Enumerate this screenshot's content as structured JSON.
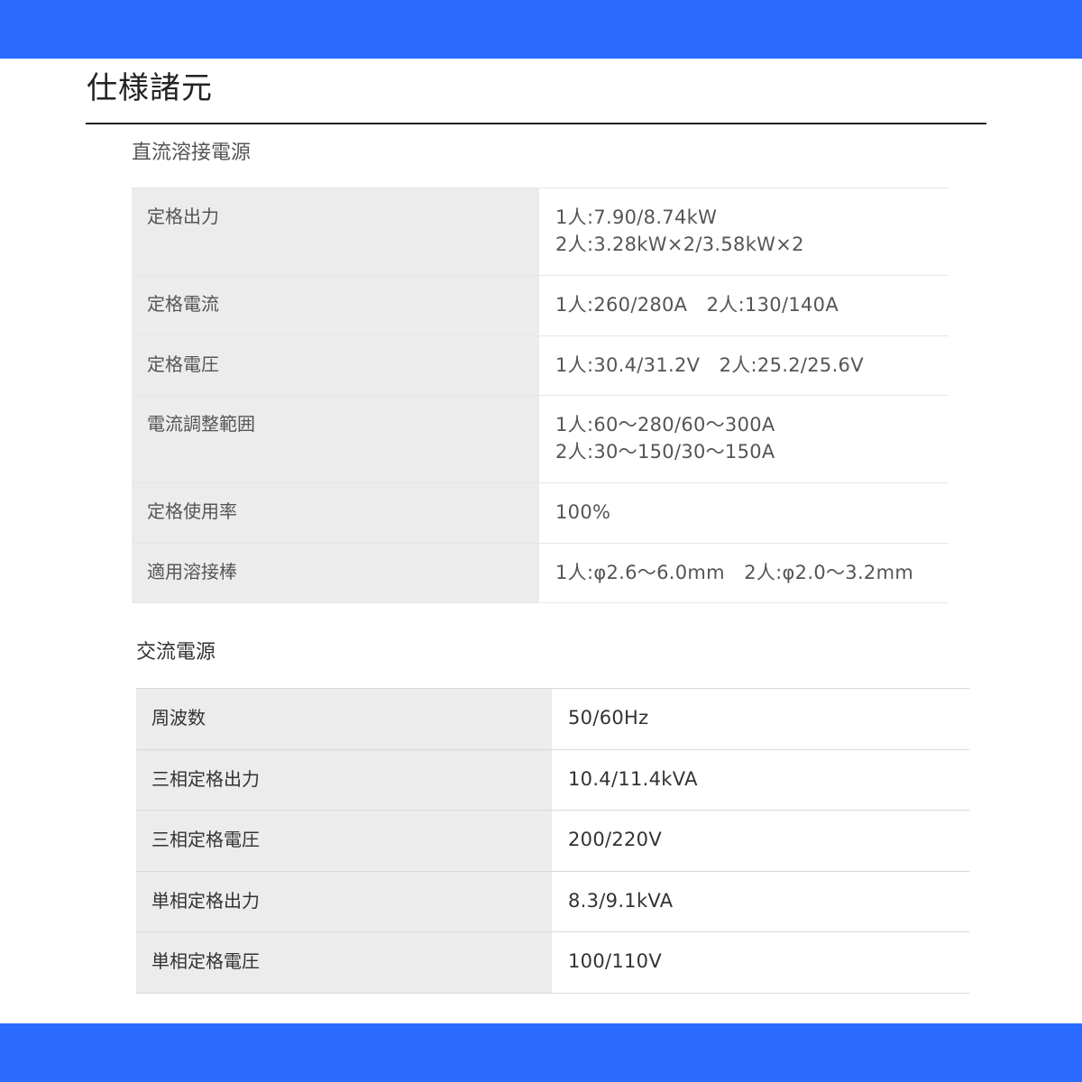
{
  "colors": {
    "accent_bar": "#2a6aff",
    "label_cell_bg": "#ececec",
    "title_rule": "#222222"
  },
  "page_title": "仕様諸元",
  "dc_section": {
    "heading": "直流溶接電源",
    "rows": [
      {
        "label": "定格出力",
        "values": [
          "1人:7.90/8.74kW",
          "2人:3.28kW×2/3.58kW×2"
        ]
      },
      {
        "label": "定格電流",
        "values": [
          "1人:260/280A　2人:130/140A"
        ]
      },
      {
        "label": "定格電圧",
        "values": [
          "1人:30.4/31.2V　2人:25.2/25.6V"
        ]
      },
      {
        "label": "電流調整範囲",
        "values": [
          "1人:60～280/60～300A",
          "2人:30～150/30～150A"
        ]
      },
      {
        "label": "定格使用率",
        "values": [
          "100%"
        ]
      },
      {
        "label": "適用溶接棒",
        "values": [
          "1人:φ2.6～6.0mm　2人:φ2.0～3.2mm"
        ]
      }
    ]
  },
  "ac_section": {
    "heading": "交流電源",
    "rows": [
      {
        "label": "周波数",
        "values": [
          "50/60Hz"
        ]
      },
      {
        "label": "三相定格出力",
        "values": [
          "10.4/11.4kVA"
        ]
      },
      {
        "label": "三相定格電圧",
        "values": [
          "200/220V"
        ]
      },
      {
        "label": "単相定格出力",
        "values": [
          "8.3/9.1kVA"
        ]
      },
      {
        "label": "単相定格電圧",
        "values": [
          "100/110V"
        ]
      }
    ]
  }
}
